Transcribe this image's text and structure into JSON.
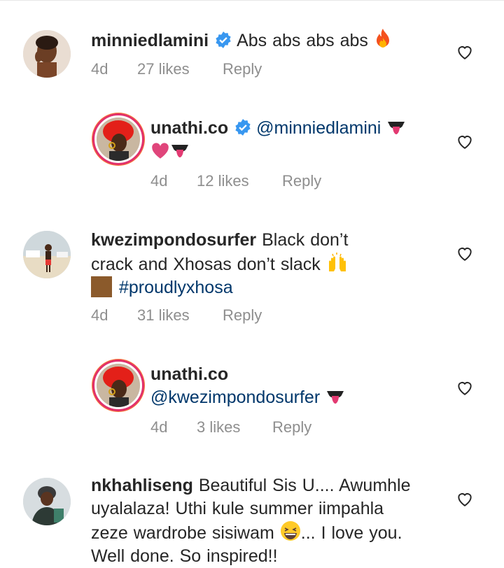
{
  "comments": [
    {
      "username": "minniedlamini",
      "verified": true,
      "text": "Abs abs abs abs",
      "emoji": "fire-icon",
      "time": "4d",
      "likes": "27 likes",
      "reply": "Reply"
    },
    {
      "username": "unathi.co",
      "verified": true,
      "mention": "@minniedlamini",
      "text": "",
      "time": "4d",
      "likes": "12 likes",
      "reply": "Reply"
    },
    {
      "username": "kwezimpondosurfer",
      "verified": false,
      "text_line1": "Black don’t",
      "text_line2": "crack and Xhosas don’t slack",
      "hashtag": "#proudlyxhosa",
      "time": "4d",
      "likes": "31 likes",
      "reply": "Reply"
    },
    {
      "username": "unathi.co",
      "verified": false,
      "mention": "@kwezimpondosurfer",
      "time": "4d",
      "likes": "3 likes",
      "reply": "Reply"
    },
    {
      "username": "nkhahliseng",
      "verified": false,
      "text_line1": "Beautiful Sis U.... Awumhle",
      "text_line2": "uyalalaza! Uthi kule summer iimpahla",
      "text_line3a": "zeze wardrobe sisiwam",
      "text_line3b": "... I love you.",
      "text_line4": "Well done. So inspired!!"
    }
  ],
  "colors": {
    "mention": "#00376b",
    "meta": "#8e8e8e",
    "verified": "#3897f0"
  }
}
